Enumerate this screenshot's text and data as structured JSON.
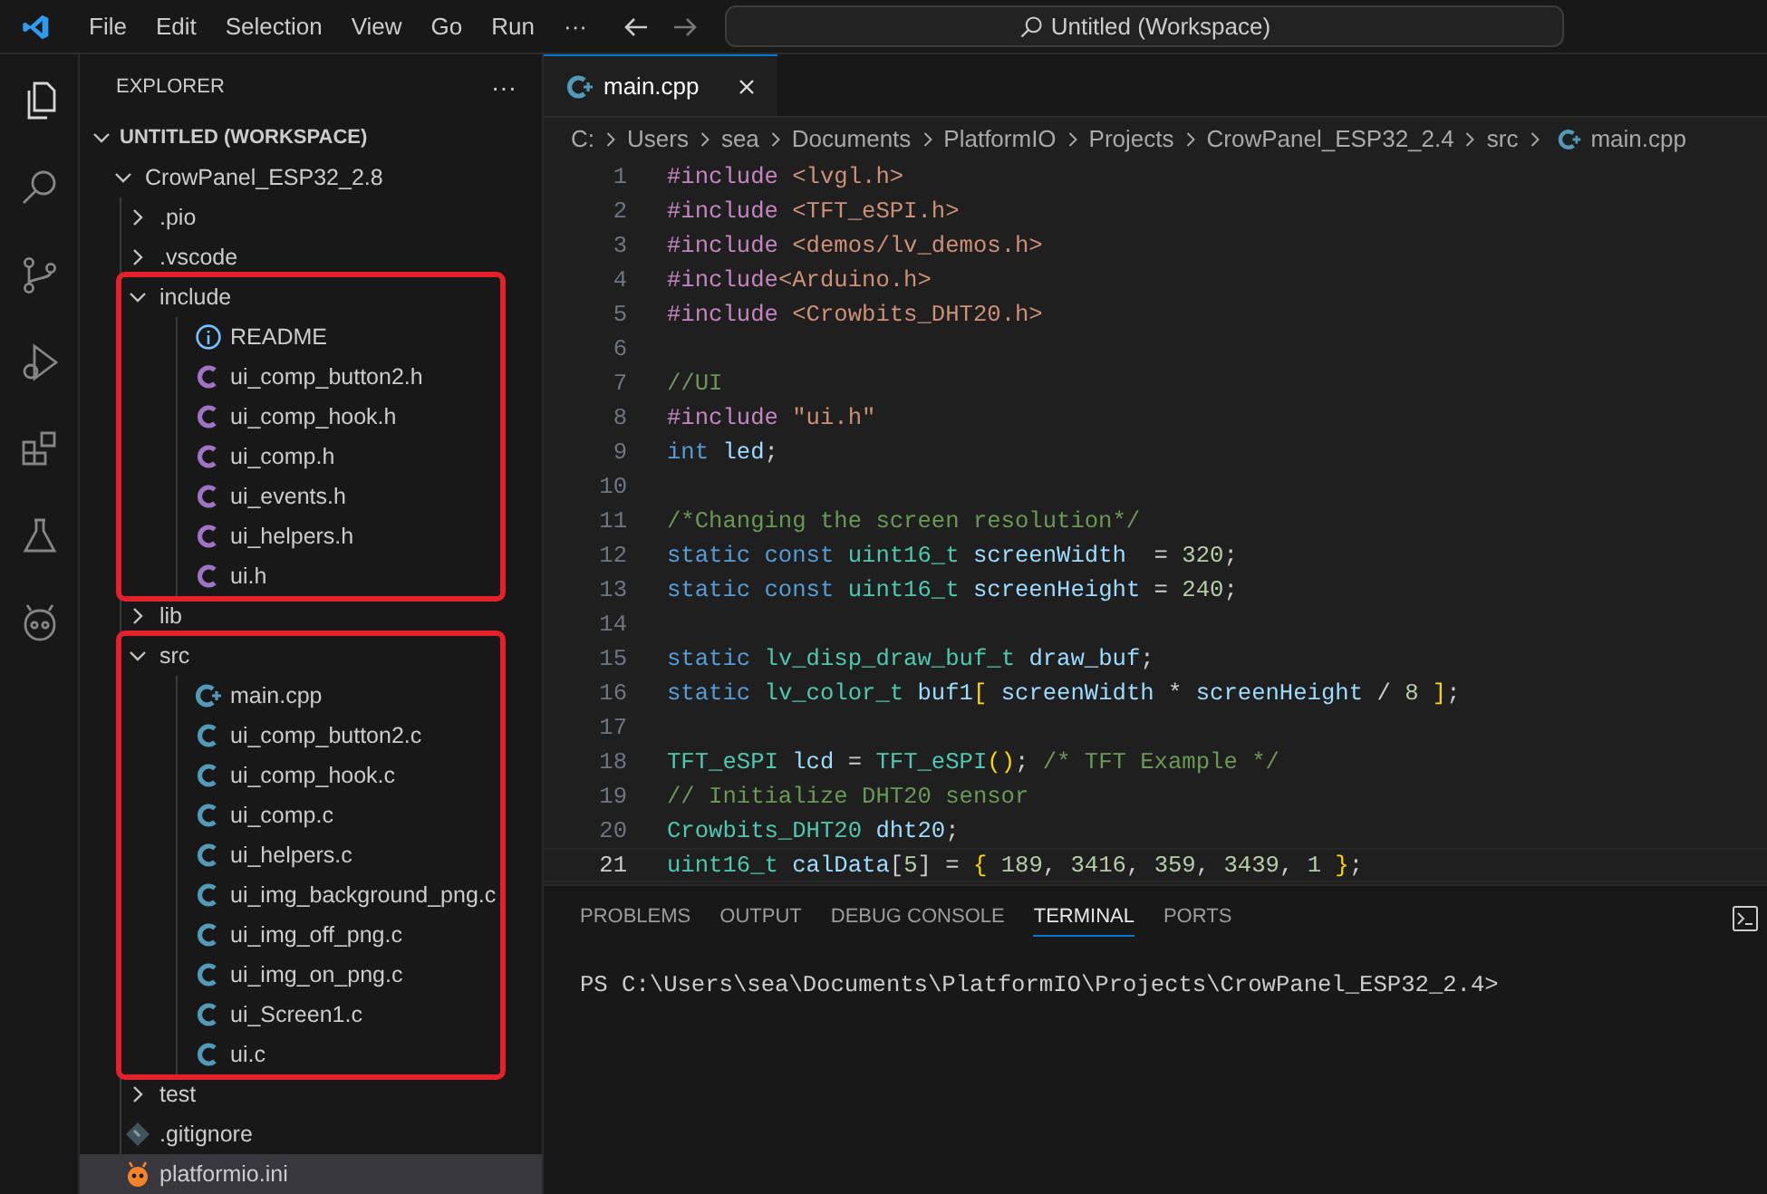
{
  "menu": [
    "File",
    "Edit",
    "Selection",
    "View",
    "Go",
    "Run",
    "···"
  ],
  "command_center": {
    "text": "Untitled (Workspace)"
  },
  "activity_bar": [
    {
      "kind": "files",
      "selected": true
    },
    {
      "kind": "search",
      "selected": false
    },
    {
      "kind": "source-control",
      "selected": false
    },
    {
      "kind": "run-debug",
      "selected": false
    },
    {
      "kind": "extensions",
      "selected": false
    },
    {
      "kind": "testing",
      "selected": false
    },
    {
      "kind": "platformio",
      "selected": false
    }
  ],
  "sidebar": {
    "title": "EXPLORER",
    "more": "···",
    "workspace": {
      "label": "UNTITLED (WORKSPACE)",
      "expanded": true,
      "children": [
        {
          "label": "CrowPanel_ESP32_2.8",
          "kind": "folder",
          "expanded": true,
          "selected": false,
          "children": [
            {
              "label": ".pio",
              "kind": "folder",
              "expanded": false,
              "selected": false,
              "highlighted": false
            },
            {
              "label": ".vscode",
              "kind": "folder",
              "expanded": false,
              "selected": false,
              "highlighted": false
            },
            {
              "label": "include",
              "kind": "folder",
              "expanded": true,
              "selected": false,
              "highlighted": true,
              "children": [
                {
                  "label": "README",
                  "kind": "info",
                  "selected": false
                },
                {
                  "label": "ui_comp_button2.h",
                  "kind": "h",
                  "selected": false
                },
                {
                  "label": "ui_comp_hook.h",
                  "kind": "h",
                  "selected": false
                },
                {
                  "label": "ui_comp.h",
                  "kind": "h",
                  "selected": false
                },
                {
                  "label": "ui_events.h",
                  "kind": "h",
                  "selected": false
                },
                {
                  "label": "ui_helpers.h",
                  "kind": "h",
                  "selected": false
                },
                {
                  "label": "ui.h",
                  "kind": "h",
                  "selected": false
                }
              ]
            },
            {
              "label": "lib",
              "kind": "folder",
              "expanded": false,
              "selected": false,
              "highlighted": false
            },
            {
              "label": "src",
              "kind": "folder",
              "expanded": true,
              "selected": false,
              "highlighted": true,
              "children": [
                {
                  "label": "main.cpp",
                  "kind": "cpp",
                  "selected": false
                },
                {
                  "label": "ui_comp_button2.c",
                  "kind": "c",
                  "selected": false
                },
                {
                  "label": "ui_comp_hook.c",
                  "kind": "c",
                  "selected": false
                },
                {
                  "label": "ui_comp.c",
                  "kind": "c",
                  "selected": false
                },
                {
                  "label": "ui_helpers.c",
                  "kind": "c",
                  "selected": false
                },
                {
                  "label": "ui_img_background_png.c",
                  "kind": "c",
                  "selected": false
                },
                {
                  "label": "ui_img_off_png.c",
                  "kind": "c",
                  "selected": false
                },
                {
                  "label": "ui_img_on_png.c",
                  "kind": "c",
                  "selected": false
                },
                {
                  "label": "ui_Screen1.c",
                  "kind": "c",
                  "selected": false
                },
                {
                  "label": "ui.c",
                  "kind": "c",
                  "selected": false
                }
              ]
            },
            {
              "label": "test",
              "kind": "folder",
              "expanded": false,
              "selected": false,
              "highlighted": false
            },
            {
              "label": ".gitignore",
              "kind": "git",
              "selected": false,
              "highlighted": false
            },
            {
              "label": "platformio.ini",
              "kind": "pio",
              "selected": true,
              "highlighted": false
            }
          ]
        }
      ]
    }
  },
  "editor": {
    "tabs": [
      {
        "label": "main.cpp",
        "kind": "cpp",
        "selected": true
      }
    ],
    "breadcrumb": [
      {
        "text": "C:"
      },
      {
        "text": "Users"
      },
      {
        "text": "sea"
      },
      {
        "text": "Documents"
      },
      {
        "text": "PlatformIO"
      },
      {
        "text": "Projects"
      },
      {
        "text": "CrowPanel_ESP32_2.4"
      },
      {
        "text": "src"
      },
      {
        "text": "main.cpp",
        "kind": "cpp"
      }
    ],
    "lines": [
      {
        "number": "1",
        "current": false,
        "tokens": [
          {
            "kind": "directive",
            "text": "#include "
          },
          {
            "kind": "string",
            "text": "<lvgl.h>"
          }
        ]
      },
      {
        "number": "2",
        "current": false,
        "tokens": [
          {
            "kind": "directive",
            "text": "#include "
          },
          {
            "kind": "string",
            "text": "<TFT_eSPI.h>"
          }
        ]
      },
      {
        "number": "3",
        "current": false,
        "tokens": [
          {
            "kind": "directive",
            "text": "#include "
          },
          {
            "kind": "string",
            "text": "<demos/lv_demos.h>"
          }
        ]
      },
      {
        "number": "4",
        "current": false,
        "tokens": [
          {
            "kind": "directive",
            "text": "#include"
          },
          {
            "kind": "string",
            "text": "<Arduino.h>"
          }
        ]
      },
      {
        "number": "5",
        "current": false,
        "tokens": [
          {
            "kind": "directive",
            "text": "#include "
          },
          {
            "kind": "string",
            "text": "<Crowbits_DHT20.h>"
          }
        ]
      },
      {
        "number": "6",
        "current": false
      },
      {
        "number": "7",
        "current": false,
        "tokens": [
          {
            "kind": "comment",
            "text": "//UI"
          }
        ]
      },
      {
        "number": "8",
        "current": false,
        "tokens": [
          {
            "kind": "directive",
            "text": "#include "
          },
          {
            "kind": "string",
            "text": "\"ui.h\""
          }
        ]
      },
      {
        "number": "9",
        "current": false,
        "tokens": [
          {
            "kind": "keyword",
            "text": "int "
          },
          {
            "kind": "variable",
            "text": "led"
          },
          {
            "kind": "plain",
            "text": ";"
          }
        ]
      },
      {
        "number": "10",
        "current": false
      },
      {
        "number": "11",
        "current": false,
        "tokens": [
          {
            "kind": "comment",
            "text": "/*Changing the screen resolution*/"
          }
        ]
      },
      {
        "number": "12",
        "current": false,
        "tokens": [
          {
            "kind": "keyword",
            "text": "static const "
          },
          {
            "kind": "type",
            "text": "uint16_t "
          },
          {
            "kind": "variable",
            "text": "screenWidth"
          },
          {
            "kind": "plain",
            "text": "  = "
          },
          {
            "kind": "number",
            "text": "320"
          },
          {
            "kind": "plain",
            "text": ";"
          }
        ]
      },
      {
        "number": "13",
        "current": false,
        "tokens": [
          {
            "kind": "keyword",
            "text": "static const "
          },
          {
            "kind": "type",
            "text": "uint16_t "
          },
          {
            "kind": "variable",
            "text": "screenHeight"
          },
          {
            "kind": "plain",
            "text": " = "
          },
          {
            "kind": "number",
            "text": "240"
          },
          {
            "kind": "plain",
            "text": ";"
          }
        ]
      },
      {
        "number": "14",
        "current": false
      },
      {
        "number": "15",
        "current": false,
        "tokens": [
          {
            "kind": "keyword",
            "text": "static "
          },
          {
            "kind": "type",
            "text": "lv_disp_draw_buf_t "
          },
          {
            "kind": "variable",
            "text": "draw_buf"
          },
          {
            "kind": "plain",
            "text": ";"
          }
        ]
      },
      {
        "number": "16",
        "current": false,
        "tokens": [
          {
            "kind": "keyword",
            "text": "static "
          },
          {
            "kind": "type",
            "text": "lv_color_t "
          },
          {
            "kind": "variable",
            "text": "buf1"
          },
          {
            "kind": "bracket",
            "text": "["
          },
          {
            "kind": "variable",
            "text": " screenWidth"
          },
          {
            "kind": "plain",
            "text": " * "
          },
          {
            "kind": "variable",
            "text": "screenHeight"
          },
          {
            "kind": "plain",
            "text": " / "
          },
          {
            "kind": "number",
            "text": "8"
          },
          {
            "kind": "bracket",
            "text": " ]"
          },
          {
            "kind": "plain",
            "text": ";"
          }
        ]
      },
      {
        "number": "17",
        "current": false
      },
      {
        "number": "18",
        "current": false,
        "tokens": [
          {
            "kind": "type",
            "text": "TFT_eSPI "
          },
          {
            "kind": "variable",
            "text": "lcd"
          },
          {
            "kind": "plain",
            "text": " = "
          },
          {
            "kind": "type",
            "text": "TFT_eSPI"
          },
          {
            "kind": "bracket",
            "text": "()"
          },
          {
            "kind": "plain",
            "text": "; "
          },
          {
            "kind": "comment",
            "text": "/* TFT Example */"
          }
        ]
      },
      {
        "number": "19",
        "current": false,
        "tokens": [
          {
            "kind": "comment",
            "text": "// Initialize DHT20 sensor"
          }
        ]
      },
      {
        "number": "20",
        "current": false,
        "tokens": [
          {
            "kind": "type",
            "text": "Crowbits_DHT20 "
          },
          {
            "kind": "variable",
            "text": "dht20"
          },
          {
            "kind": "plain",
            "text": ";"
          }
        ]
      },
      {
        "number": "21",
        "current": true,
        "tokens": [
          {
            "kind": "type",
            "text": "uint16_t "
          },
          {
            "kind": "variable",
            "text": "calData"
          },
          {
            "kind": "plain",
            "text": "["
          },
          {
            "kind": "number",
            "text": "5"
          },
          {
            "kind": "plain",
            "text": "] = "
          },
          {
            "kind": "bracket",
            "text": "{"
          },
          {
            "kind": "number",
            "text": " 189"
          },
          {
            "kind": "plain",
            "text": ", "
          },
          {
            "kind": "number",
            "text": "3416"
          },
          {
            "kind": "plain",
            "text": ", "
          },
          {
            "kind": "number",
            "text": "359"
          },
          {
            "kind": "plain",
            "text": ", "
          },
          {
            "kind": "number",
            "text": "3439"
          },
          {
            "kind": "plain",
            "text": ", "
          },
          {
            "kind": "number",
            "text": "1"
          },
          {
            "kind": "bracket",
            "text": " }"
          },
          {
            "kind": "plain",
            "text": ";"
          }
        ]
      }
    ]
  },
  "panel": {
    "tabs": [
      {
        "label": "PROBLEMS",
        "selected": false
      },
      {
        "label": "OUTPUT",
        "selected": false
      },
      {
        "label": "DEBUG CONSOLE",
        "selected": false
      },
      {
        "label": "TERMINAL",
        "selected": true
      },
      {
        "label": "PORTS",
        "selected": false
      }
    ],
    "terminal_lines": [
      "PS C:\\Users\\sea\\Documents\\PlatformIO\\Projects\\CrowPanel_ESP32_2.4>"
    ]
  }
}
